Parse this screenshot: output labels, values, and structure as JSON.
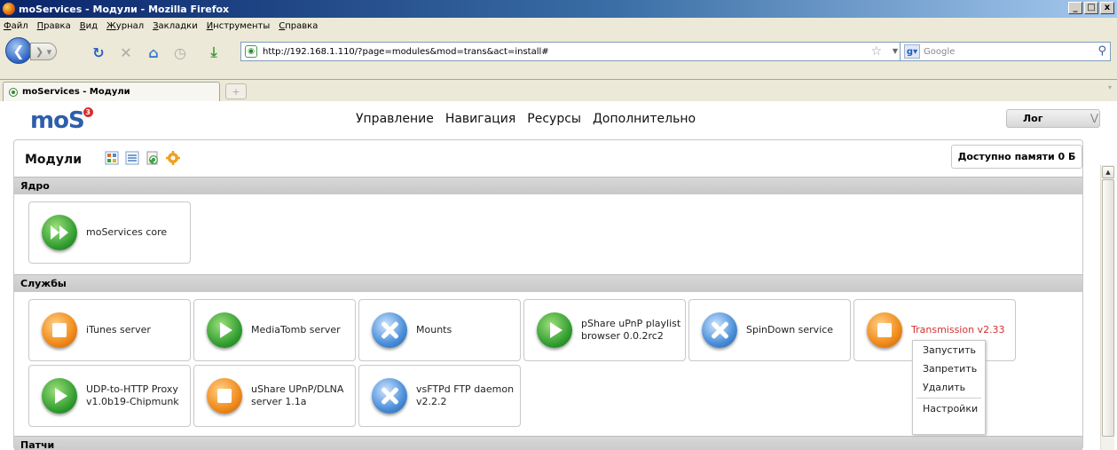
{
  "window": {
    "title": "moServices - Модули - Mozilla Firefox",
    "min": "_",
    "max": "□",
    "close": "x"
  },
  "menubar": [
    "Файл",
    "Правка",
    "Вид",
    "Журнал",
    "Закладки",
    "Инструменты",
    "Справка"
  ],
  "nav": {
    "url": "http://192.168.1.110/?page=modules&mod=trans&act=install#",
    "search_placeholder": "Google"
  },
  "tabs": [
    {
      "label": "moServices - Модули"
    }
  ],
  "app": {
    "logo": "moS",
    "logo_badge": "3",
    "topnav": [
      "Управление",
      "Навигация",
      "Ресурсы",
      "Дополнительно"
    ],
    "log_button": "Лог"
  },
  "panel": {
    "title": "Модули",
    "memory": "Доступно памяти 0 Б",
    "sections": [
      {
        "title": "Ядро",
        "modules": [
          {
            "name": "moServices core",
            "icon": "fast-forward-icon"
          }
        ]
      },
      {
        "title": "Службы",
        "modules": [
          {
            "name": "iTunes server",
            "icon": "stop-icon"
          },
          {
            "name": "MediaTomb server",
            "icon": "play-icon"
          },
          {
            "name": "Mounts",
            "icon": "cross-icon"
          },
          {
            "name": "pShare uPnP playlist browser 0.0.2rc2",
            "icon": "play-icon"
          },
          {
            "name": "SpinDown service",
            "icon": "cross-icon"
          },
          {
            "name": "Transmission v2.33",
            "icon": "stop-icon"
          },
          {
            "name": "UDP-to-HTTP Proxy v1.0b19-Chipmunk",
            "icon": "play-icon"
          },
          {
            "name": "uShare UPnP/DLNA server 1.1a",
            "icon": "stop-icon"
          },
          {
            "name": "vsFTPd FTP daemon v2.2.2",
            "icon": "cross-icon"
          }
        ]
      },
      {
        "title": "Патчи",
        "modules": []
      }
    ]
  },
  "context_menu": [
    "Запустить",
    "Запретить",
    "Удалить",
    "Настройки"
  ],
  "colors": {
    "accent": "#2e5eaa",
    "selected_module": "#d73030"
  }
}
